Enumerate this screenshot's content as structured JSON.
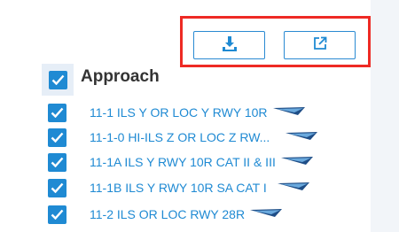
{
  "toolbar": {
    "download_icon": "download-icon",
    "external_icon": "open-external-icon"
  },
  "section": {
    "title": "Approach",
    "checked": true
  },
  "charts": [
    {
      "label": "11-1 ILS Y OR LOC Y RWY 10R",
      "checked": true
    },
    {
      "label": "11-1-0 HI-ILS Z OR LOC Z RW...",
      "checked": true
    },
    {
      "label": "11-1A ILS Y RWY 10R CAT II & III",
      "checked": true
    },
    {
      "label": "11-1B ILS Y RWY 10R SA CAT I",
      "checked": true
    },
    {
      "label": "11-2 ILS OR LOC RWY 28R",
      "checked": true
    }
  ],
  "colors": {
    "accent": "#1f8ad3",
    "highlight": "#ee2a24",
    "section_bg": "#e6eef7"
  }
}
